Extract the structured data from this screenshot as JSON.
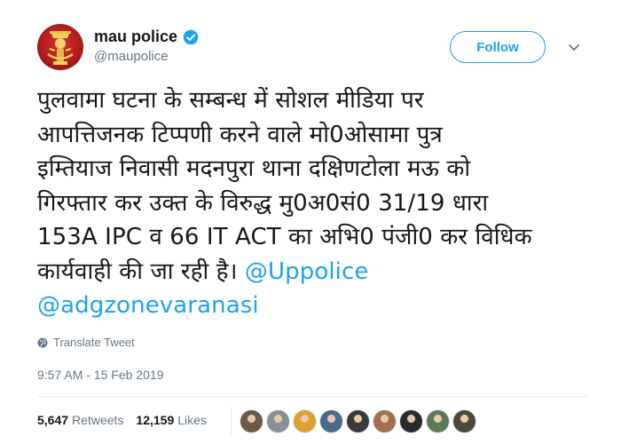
{
  "user": {
    "name": "mau police",
    "handle": "@maupolice",
    "verified": true,
    "avatar_icon": "police-emblem-icon"
  },
  "follow": {
    "label": "Follow"
  },
  "tweet": {
    "lines": [
      "पुलवामा घटना के सम्बन्ध में सोशल मीडिया पर",
      "आपत्तिजनक टिप्पणी करने वाले मो0ओसामा पुत्र",
      "इम्तियाज निवासी मदनपुरा थाना दक्षिणटोला मऊ को",
      "गिरफ्तार कर उक्त के विरुद्ध मु0अ0सं0 31/19 धारा",
      "153A IPC व 66 IT ACT का अभि0 पंजी0 कर विधिक",
      "कार्यवाही की जा रही है। "
    ],
    "mention_1": "@Uppolice",
    "mention_2": "@adgzonevaranasi"
  },
  "translate": {
    "label": "Translate Tweet",
    "icon": "globe-icon"
  },
  "timestamp": "9:57 AM - 15 Feb 2019",
  "stats": {
    "retweets_count": "5,647",
    "retweets_label": "Retweets",
    "likes_count": "12,159",
    "likes_label": "Likes"
  },
  "liker_avatars": [
    {
      "color": "#6b5a4a"
    },
    {
      "color": "#8a8f96"
    },
    {
      "color": "#e0a030"
    },
    {
      "color": "#4a6a8a"
    },
    {
      "color": "#3a3a3a"
    },
    {
      "color": "#a07050"
    },
    {
      "color": "#2a2a2a"
    },
    {
      "color": "#5a7a5a"
    },
    {
      "color": "#4a4a3a"
    }
  ],
  "colors": {
    "accent": "#1da1f2",
    "text": "#14171a",
    "muted": "#657786"
  }
}
